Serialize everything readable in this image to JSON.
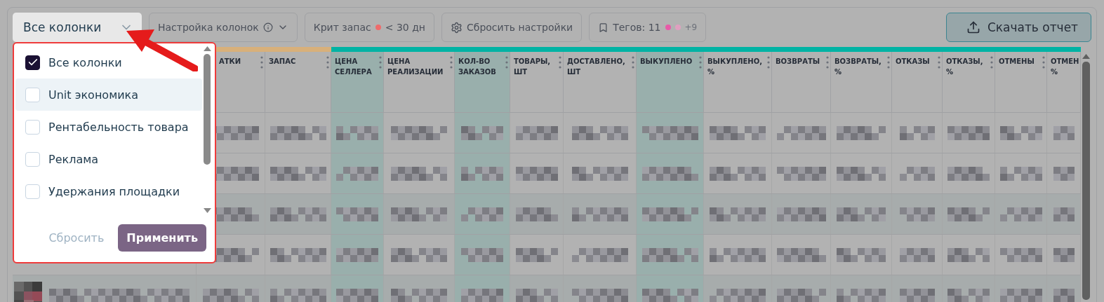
{
  "toolbar": {
    "column_select": {
      "value": "Все колонки",
      "open": true
    },
    "buttons": [
      {
        "kind": "settings",
        "label": "Настройка колонок"
      },
      {
        "kind": "crit",
        "label": "Крит запас",
        "value": "< 30 дн"
      },
      {
        "kind": "reset",
        "label": "Сбросить настройки"
      },
      {
        "kind": "tags",
        "label": "Тегов: 11",
        "more": "+9",
        "dots": [
          {
            "color": "#e85aa8"
          },
          {
            "color": "#e0a0c0"
          }
        ]
      }
    ],
    "download": {
      "label": "Скачать отчет"
    }
  },
  "column_popup": {
    "items": [
      {
        "label": "Все колонки",
        "checked": true,
        "hovered": false
      },
      {
        "label": "Unit экономика",
        "checked": false,
        "hovered": true
      },
      {
        "label": "Рентабельность товара",
        "checked": false,
        "hovered": false
      },
      {
        "label": "Реклама",
        "checked": false,
        "hovered": false
      },
      {
        "label": "Удержания площадки",
        "checked": false,
        "hovered": false
      }
    ],
    "reset": "Сбросить",
    "apply": "Применить"
  },
  "table": {
    "columns": [
      {
        "label": "АТКИ",
        "color": "#d8b07a",
        "highlighted": false
      },
      {
        "label": "ЗАПАС",
        "color": "#d8b07a",
        "highlighted": false
      },
      {
        "label": "ЦЕНА СЕЛЛЕРА",
        "color": "#00b3a4",
        "highlighted": true
      },
      {
        "label": "ЦЕНА РЕАЛИЗАЦИИ",
        "color": "#00b3a4",
        "highlighted": false
      },
      {
        "label": "КОЛ-ВО ЗАКАЗОВ",
        "color": "#00b3a4",
        "highlighted": true
      },
      {
        "label": "ТОВАРЫ, ШТ",
        "color": "#00b3a4",
        "highlighted": false
      },
      {
        "label": "ДОСТАВЛЕНО, ШТ",
        "color": "#00b3a4",
        "highlighted": false
      },
      {
        "label": "ВЫКУПЛЕНО",
        "color": "#00b3a4",
        "highlighted": true
      },
      {
        "label": "ВЫКУПЛЕНО, %",
        "color": "#00b3a4",
        "highlighted": false
      },
      {
        "label": "ВОЗВРАТЫ",
        "color": "#00b3a4",
        "highlighted": false
      },
      {
        "label": "ВОЗВРАТЫ, %",
        "color": "#00b3a4",
        "highlighted": false
      },
      {
        "label": "ОТКАЗЫ",
        "color": "#00b3a4",
        "highlighted": false
      },
      {
        "label": "ОТКАЗЫ, %",
        "color": "#00b3a4",
        "highlighted": false
      },
      {
        "label": "ОТМЕНЫ",
        "color": "#00b3a4",
        "highlighted": false
      },
      {
        "label": "ОТМЕН %",
        "color": "#00b3a4",
        "highlighted": false
      }
    ],
    "rows": [
      {
        "striped": false
      },
      {
        "striped": false
      },
      {
        "striped": true
      },
      {
        "striped": false
      },
      {
        "striped": true
      }
    ]
  }
}
